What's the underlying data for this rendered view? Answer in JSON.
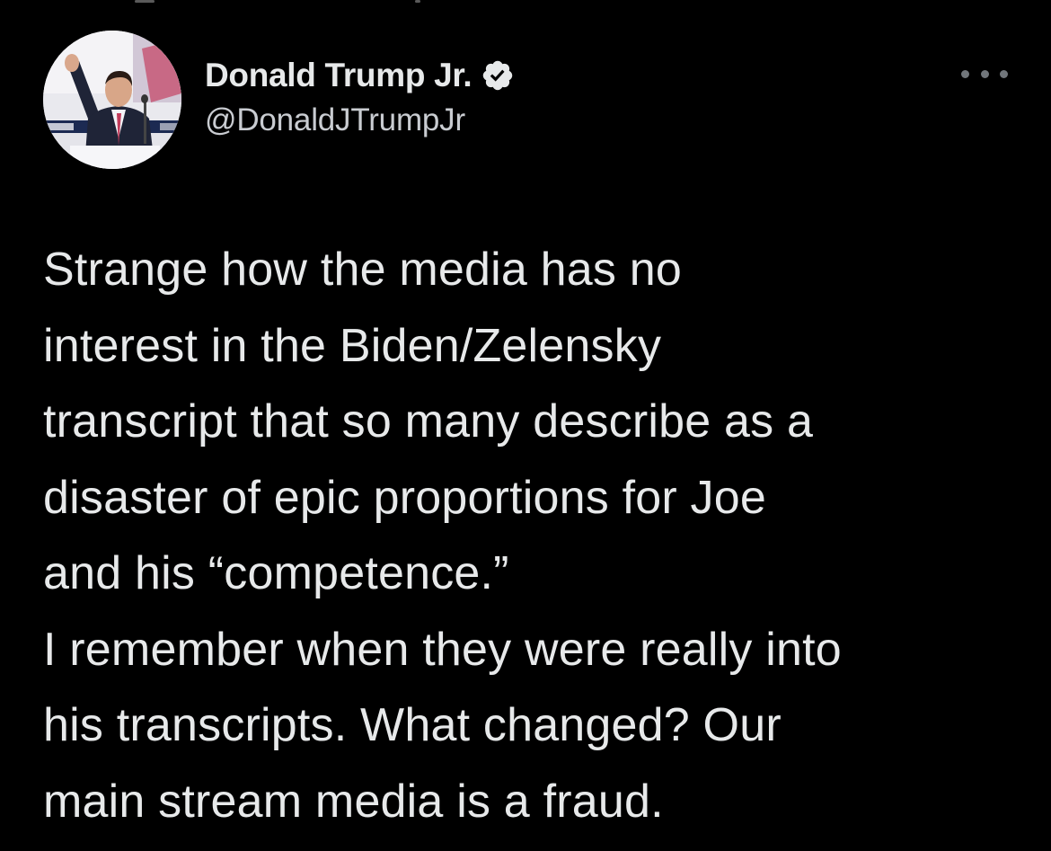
{
  "tweet": {
    "author": {
      "display_name": "Donald Trump Jr.",
      "handle": "@DonaldJTrumpJr",
      "verified": true,
      "avatar_icon": "profile-photo",
      "verified_icon": "verified-badge-icon"
    },
    "more_icon": "more-options-icon",
    "text_lines": [
      "Strange how the media has no",
      "interest in the Biden/Zelensky",
      "transcript that so many describe as a",
      "disaster of epic proportions for Joe",
      "and his “competence.”",
      "I remember when they were really into",
      "his transcripts. What changed? Our",
      "main stream media is a fraud."
    ]
  },
  "colors": {
    "background": "#000000",
    "text_primary": "#e7e9ea",
    "text_secondary": "#c9ccd1",
    "icon_muted": "#71767b"
  }
}
